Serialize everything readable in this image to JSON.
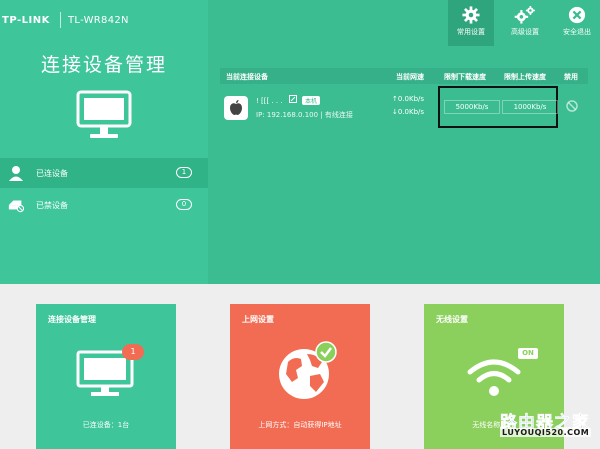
{
  "header": {
    "brand": "TP-LINK",
    "model": "TL-WR842N"
  },
  "toolbar": {
    "items": [
      {
        "label": "常用设置",
        "icon": "gear-icon",
        "active": true
      },
      {
        "label": "高级设置",
        "icon": "gears-icon",
        "active": false
      },
      {
        "label": "安全退出",
        "icon": "close-circle-icon",
        "active": false
      }
    ]
  },
  "sidebar": {
    "title": "连接设备管理",
    "items": [
      {
        "label": "已连设备",
        "count": "1",
        "icon": "user-icon",
        "active": true
      },
      {
        "label": "已禁设备",
        "count": "0",
        "icon": "blocked-router-icon",
        "active": false
      }
    ]
  },
  "device_table": {
    "headers": [
      "当前连接设备",
      "当前网速",
      "限制下载速度",
      "限制上传速度",
      "禁用"
    ],
    "rows": [
      {
        "icon": "apple-icon",
        "name": "! [[[ . . .",
        "tag": "本机",
        "ip": "IP: 192.168.0.100 | 有线连接",
        "rate_up": "↑0.0Kb/s",
        "rate_down": "↓0.0Kb/s",
        "limit_down": "5000Kb/s",
        "limit_up": "1000Kb/s"
      }
    ]
  },
  "cards": [
    {
      "title": "连接设备管理",
      "footer": "已连设备：1台",
      "badge": "1",
      "color": "#3ec69a",
      "icon": "monitor-icon"
    },
    {
      "title": "上网设置",
      "footer": "上网方式：自动获得IP地址",
      "color": "#f26c53",
      "icon": "globe-icon"
    },
    {
      "title": "无线设置",
      "footer": "无线名称：TP",
      "badge": "ON",
      "color": "#8bd05c",
      "icon": "wifi-icon"
    }
  ],
  "watermark": {
    "line1": "路由器之家",
    "line2": "LUYOUQI520.COM"
  },
  "colors": {
    "sidebar": "#3ec69a",
    "main": "#3bbd91",
    "highlight_border": "#111111",
    "card_green": "#3ec69a",
    "card_red": "#f26c53",
    "card_lime": "#8bd05c"
  }
}
